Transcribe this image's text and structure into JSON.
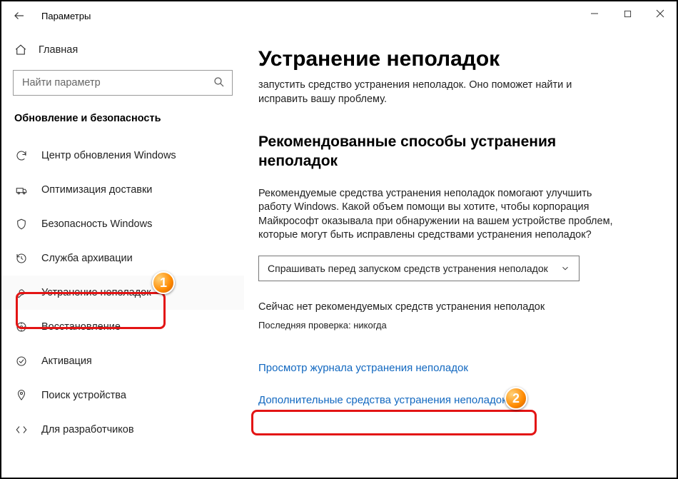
{
  "window": {
    "title": "Параметры"
  },
  "sidebar": {
    "home_label": "Главная",
    "search_placeholder": "Найти параметр",
    "section_title": "Обновление и безопасность",
    "items": [
      {
        "label": "Центр обновления Windows",
        "icon": "sync-icon"
      },
      {
        "label": "Оптимизация доставки",
        "icon": "delivery-icon"
      },
      {
        "label": "Безопасность Windows",
        "icon": "shield-icon"
      },
      {
        "label": "Служба архивации",
        "icon": "backup-icon"
      },
      {
        "label": "Устранение неполадок",
        "icon": "wrench-icon"
      },
      {
        "label": "Восстановление",
        "icon": "recovery-icon"
      },
      {
        "label": "Активация",
        "icon": "activation-icon"
      },
      {
        "label": "Поиск устройства",
        "icon": "find-device-icon"
      },
      {
        "label": "Для разработчиков",
        "icon": "developer-icon"
      }
    ]
  },
  "main": {
    "heading": "Устранение неполадок",
    "lead": "запустить средство устранения неполадок. Оно поможет найти и исправить вашу проблему.",
    "subheading": "Рекомендованные способы устранения неполадок",
    "desc": "Рекомендуемые средства устранения неполадок помогают улучшить работу Windows. Какой объем помощи вы хотите, чтобы корпорация Майкрософт оказывала при обнаружении на вашем устройстве проблем, которые могут быть исправлены средствами устранения неполадок?",
    "dropdown_value": "Спрашивать перед запуском средств устранения неполадок",
    "status_line": "Сейчас нет рекомендуемых средств устранения неполадок",
    "status_sub": "Последняя проверка: никогда",
    "link_history": "Просмотр журнала устранения неполадок",
    "link_additional": "Дополнительные средства устранения неполадок"
  },
  "annotations": {
    "badge1": "1",
    "badge2": "2"
  }
}
